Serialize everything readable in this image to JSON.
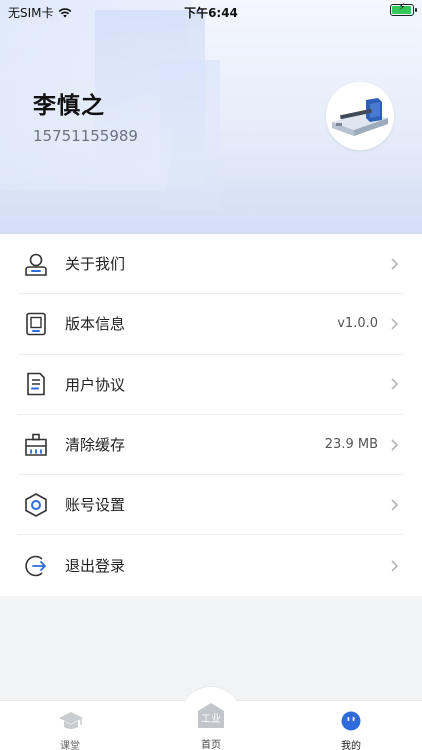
{
  "status_bar": {
    "carrier": "无SIM卡",
    "time": "下午6:44",
    "battery_level": 0.85
  },
  "profile": {
    "name": "李慎之",
    "phone": "15751155989"
  },
  "menu": [
    {
      "label": "关于我们",
      "value": ""
    },
    {
      "label": "版本信息",
      "value": "v1.0.0"
    },
    {
      "label": "用户协议",
      "value": ""
    },
    {
      "label": "清除缓存",
      "value": "23.9 MB"
    },
    {
      "label": "账号设置",
      "value": ""
    },
    {
      "label": "退出登录",
      "value": ""
    }
  ],
  "tabbar": {
    "classroom": "课堂",
    "home": "首页",
    "home_badge": "工业",
    "mine": "我的"
  },
  "colors": {
    "accent": "#2f6bdc",
    "battery": "#35c759"
  }
}
